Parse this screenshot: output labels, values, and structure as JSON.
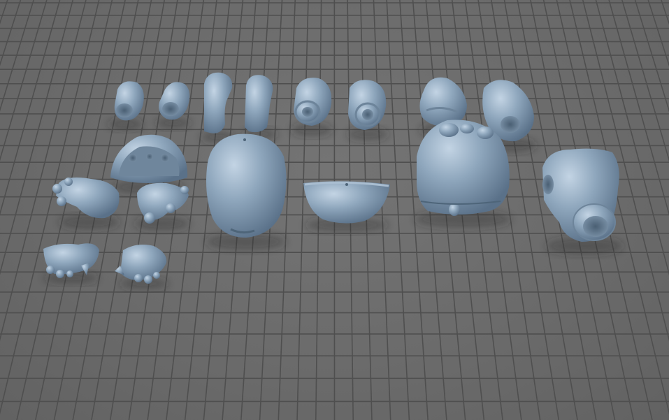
{
  "viewport": {
    "background": "#6a6a6a",
    "grid_line_color": "#4f4f4f",
    "part_color": "#8fa7bd",
    "part_shadow": "#5a7189",
    "part_highlight": "#c3d4e4"
  },
  "parts": [
    {
      "id": "upper-arm-left",
      "kind": "tube"
    },
    {
      "id": "upper-arm-right",
      "kind": "tube"
    },
    {
      "id": "ear-left",
      "kind": "ear"
    },
    {
      "id": "ear-right",
      "kind": "ear"
    },
    {
      "id": "forearm-left",
      "kind": "tube"
    },
    {
      "id": "forearm-right",
      "kind": "tube"
    },
    {
      "id": "thigh-left",
      "kind": "tube"
    },
    {
      "id": "thigh-right",
      "kind": "tube"
    },
    {
      "id": "pelvis",
      "kind": "shell"
    },
    {
      "id": "foot-left",
      "kind": "foot"
    },
    {
      "id": "foot-right",
      "kind": "foot"
    },
    {
      "id": "torso",
      "kind": "body"
    },
    {
      "id": "jaw",
      "kind": "bowl"
    },
    {
      "id": "head",
      "kind": "head"
    },
    {
      "id": "chest-piece",
      "kind": "chest"
    },
    {
      "id": "hand-left",
      "kind": "hand"
    },
    {
      "id": "hand-right",
      "kind": "hand"
    }
  ]
}
